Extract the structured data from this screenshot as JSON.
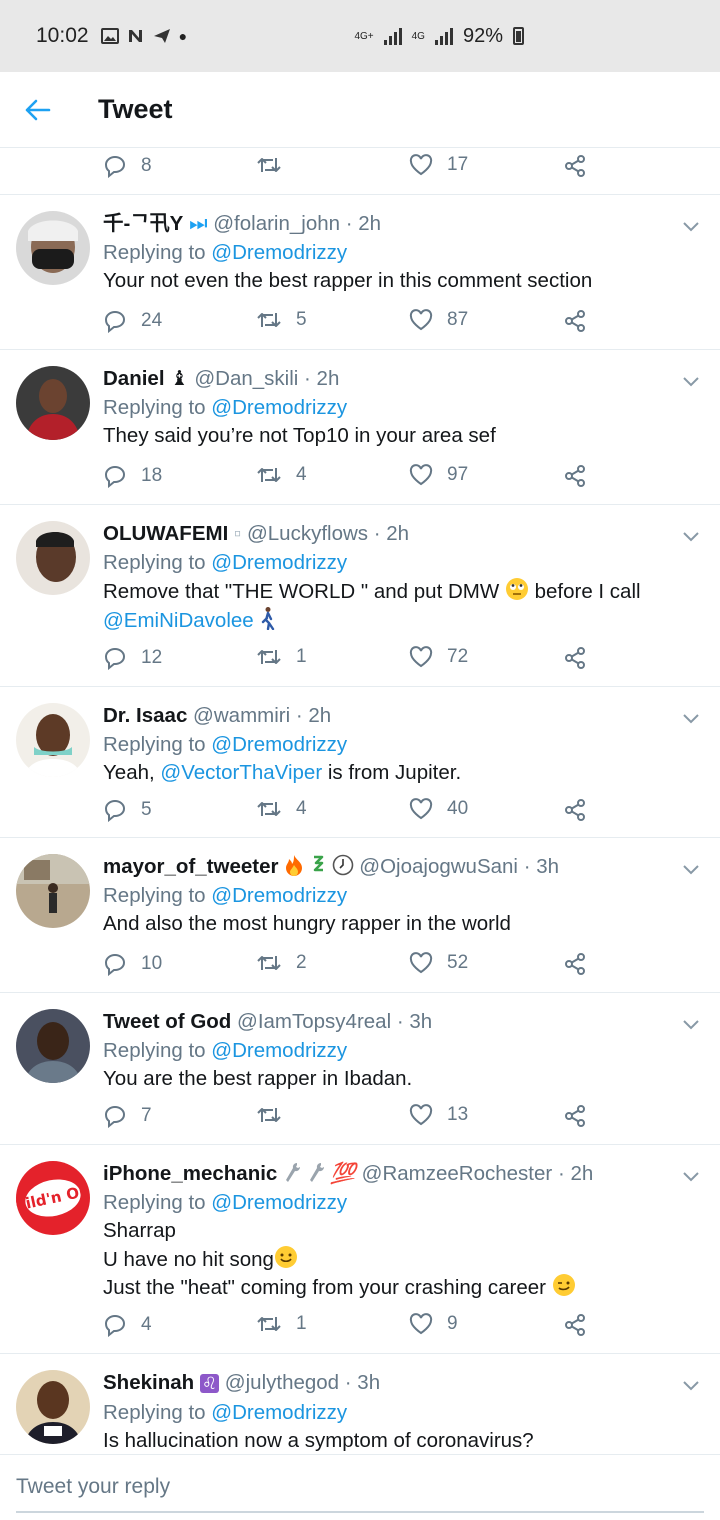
{
  "status_bar": {
    "time": "10:02",
    "network_a": "4G+",
    "network_b": "4G",
    "battery": "92%"
  },
  "header": {
    "title": "Tweet"
  },
  "top_actions": {
    "replies": "8",
    "retweets": "",
    "likes": "17"
  },
  "tweets": [
    {
      "name": "千-ᄀ卂Y",
      "badge": "⏭",
      "handle": "@folarin_john",
      "time": "· 2h",
      "replying_label": "Replying to",
      "replying_to": "@Dremodrizzy",
      "text": "Your not even the best rapper in this comment section",
      "replies": "24",
      "retweets": "5",
      "likes": "87"
    },
    {
      "name": "Daniel",
      "badge": "♝",
      "handle": "@Dan_skili",
      "time": "· 2h",
      "replying_label": "Replying to",
      "replying_to": "@Dremodrizzy",
      "text": "They said you’re not Top10 in your area sef",
      "replies": "18",
      "retweets": "4",
      "likes": "97"
    },
    {
      "name": "OLUWAFEMI",
      "badge": "▫",
      "handle": "@Luckyflows",
      "time": "· 2h",
      "replying_label": "Replying to",
      "replying_to": "@Dremodrizzy",
      "text_a": "Remove that \"THE WORLD \" and put DMW",
      "text_b": "before I call",
      "text_mention": "@EmiNiDavolee",
      "replies": "12",
      "retweets": "1",
      "likes": "72"
    },
    {
      "name": "Dr. Isaac",
      "handle": "@wammiri",
      "time": "· 2h",
      "replying_label": "Replying to",
      "replying_to": "@Dremodrizzy",
      "text_a": "Yeah,",
      "text_mention": "@VectorThaViper",
      "text_b": "is from Jupiter.",
      "replies": "5",
      "retweets": "4",
      "likes": "40"
    },
    {
      "name": "mayor_of_tweeter",
      "handle": "@OjoajogwuSani",
      "time": "· 3h",
      "replying_label": "Replying to",
      "replying_to": "@Dremodrizzy",
      "text": "And also the most hungry rapper in the world",
      "replies": "10",
      "retweets": "2",
      "likes": "52"
    },
    {
      "name": "Tweet of God",
      "handle": "@IamTopsy4real",
      "time": "· 3h",
      "replying_label": "Replying to",
      "replying_to": "@Dremodrizzy",
      "text": "You are the best rapper in Ibadan.",
      "replies": "7",
      "retweets": "",
      "likes": "13"
    },
    {
      "name": "iPhone_mechanic",
      "badge": "💯",
      "handle": "@RamzeeRochester",
      "time": "· 2h",
      "replying_label": "Replying to",
      "replying_to": "@Dremodrizzy",
      "text_l1": "Sharrap",
      "text_l2": "U have no hit song",
      "text_l3": "Just the \"heat\" coming from your crashing career",
      "avatar_text": "Wild'n Out",
      "replies": "4",
      "retweets": "1",
      "likes": "9"
    },
    {
      "name": "Shekinah",
      "badge": "♌",
      "handle": "@julythegod",
      "time": "· 3h",
      "replying_label": "Replying to",
      "replying_to": "@Dremodrizzy",
      "text": "Is hallucination now a symptom of coronavirus?"
    }
  ],
  "footer": {
    "placeholder": "Tweet your reply"
  },
  "colors": {
    "accent": "#1da1f2",
    "link": "#1b95e0",
    "muted": "#657786",
    "divider": "#e6ecf0"
  }
}
